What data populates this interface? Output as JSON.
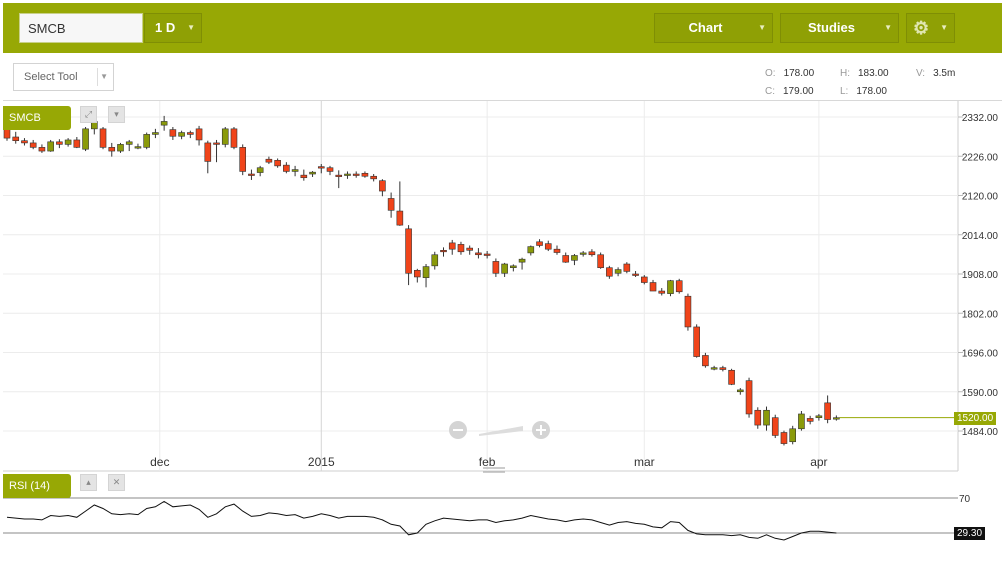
{
  "header": {
    "symbol": "SMCB",
    "interval": "1 D",
    "chart_label": "Chart",
    "studies_label": "Studies",
    "settings_icon": "gear-icon"
  },
  "toolbar": {
    "select_tool": "Select Tool"
  },
  "ohlc": {
    "o_key": "O:",
    "o_val": "178.00",
    "h_key": "H:",
    "h_val": "183.00",
    "v_key": "V:",
    "v_val": "3.5m",
    "c_key": "C:",
    "c_val": "179.00",
    "l_key": "L:",
    "l_val": "178.00"
  },
  "main_panel": {
    "series_tag": "SMCB",
    "expand_icon": "expand-icon",
    "down_icon": "arrow-down-icon",
    "current_price": "1520.00",
    "zoom_out_icon": "zoom-out-icon",
    "zoom_in_icon": "zoom-in-icon"
  },
  "rsi_panel": {
    "tag": "RSI (14)",
    "level_label": "70",
    "current_value": "29.30",
    "up_icon": "arrow-up-icon",
    "close_icon": "close-icon"
  },
  "colors": {
    "accent": "#97a805",
    "up": "#8a9a0a",
    "down": "#f0441a"
  },
  "chart_data": {
    "type": "candlestick",
    "y_ticks": [
      "2332.00",
      "2226.00",
      "2120.00",
      "2014.00",
      "1908.00",
      "1802.00",
      "1696.00",
      "1590.00",
      "1484.00"
    ],
    "x_ticks": [
      "dec",
      "2015",
      "feb",
      "mar",
      "apr"
    ],
    "ylim": [
      1460,
      2350
    ],
    "candles": [
      [
        2300,
        2315,
        2268,
        2275
      ],
      [
        2278,
        2292,
        2260,
        2268
      ],
      [
        2268,
        2275,
        2255,
        2262
      ],
      [
        2262,
        2270,
        2245,
        2250
      ],
      [
        2250,
        2258,
        2235,
        2240
      ],
      [
        2240,
        2270,
        2238,
        2265
      ],
      [
        2265,
        2272,
        2248,
        2258
      ],
      [
        2258,
        2275,
        2252,
        2270
      ],
      [
        2270,
        2278,
        2248,
        2250
      ],
      [
        2245,
        2305,
        2240,
        2300
      ],
      [
        2300,
        2330,
        2285,
        2320
      ],
      [
        2300,
        2305,
        2245,
        2250
      ],
      [
        2250,
        2262,
        2225,
        2240
      ],
      [
        2240,
        2262,
        2235,
        2258
      ],
      [
        2258,
        2270,
        2240,
        2265
      ],
      [
        2250,
        2260,
        2245,
        2252
      ],
      [
        2250,
        2290,
        2245,
        2285
      ],
      [
        2285,
        2300,
        2275,
        2290
      ],
      [
        2310,
        2335,
        2295,
        2320
      ],
      [
        2298,
        2305,
        2270,
        2280
      ],
      [
        2280,
        2295,
        2272,
        2290
      ],
      [
        2290,
        2295,
        2275,
        2285
      ],
      [
        2300,
        2308,
        2255,
        2270
      ],
      [
        2262,
        2268,
        2180,
        2212
      ],
      [
        2262,
        2270,
        2210,
        2258
      ],
      [
        2258,
        2305,
        2250,
        2300
      ],
      [
        2300,
        2305,
        2245,
        2250
      ],
      [
        2250,
        2258,
        2175,
        2185
      ],
      [
        2178,
        2190,
        2162,
        2175
      ],
      [
        2182,
        2200,
        2172,
        2195
      ],
      [
        2218,
        2225,
        2205,
        2210
      ],
      [
        2215,
        2220,
        2195,
        2200
      ],
      [
        2202,
        2210,
        2180,
        2185
      ],
      [
        2185,
        2200,
        2172,
        2190
      ],
      [
        2175,
        2190,
        2160,
        2168
      ],
      [
        2178,
        2186,
        2170,
        2183
      ],
      [
        2198,
        2205,
        2180,
        2195
      ],
      [
        2195,
        2200,
        2175,
        2185
      ],
      [
        2175,
        2188,
        2140,
        2172
      ],
      [
        2175,
        2185,
        2165,
        2178
      ],
      [
        2178,
        2185,
        2168,
        2175
      ],
      [
        2180,
        2185,
        2168,
        2172
      ],
      [
        2172,
        2178,
        2158,
        2165
      ],
      [
        2160,
        2164,
        2118,
        2132
      ],
      [
        2112,
        2128,
        2060,
        2080
      ],
      [
        2078,
        2158,
        2038,
        2040
      ],
      [
        2030,
        2040,
        1878,
        1910
      ],
      [
        1918,
        1922,
        1885,
        1900
      ],
      [
        1898,
        1935,
        1872,
        1928
      ],
      [
        1930,
        1968,
        1920,
        1960
      ],
      [
        1972,
        1980,
        1955,
        1968
      ],
      [
        1992,
        2000,
        1960,
        1975
      ],
      [
        1988,
        1995,
        1960,
        1968
      ],
      [
        1978,
        1985,
        1960,
        1972
      ],
      [
        1965,
        1978,
        1950,
        1960
      ],
      [
        1962,
        1970,
        1950,
        1958
      ],
      [
        1942,
        1950,
        1900,
        1910
      ],
      [
        1910,
        1938,
        1900,
        1935
      ],
      [
        1925,
        1934,
        1915,
        1930
      ],
      [
        1940,
        1952,
        1920,
        1948
      ],
      [
        1965,
        1985,
        1958,
        1982
      ],
      [
        1995,
        2002,
        1980,
        1985
      ],
      [
        1990,
        1998,
        1970,
        1975
      ],
      [
        1975,
        1985,
        1960,
        1966
      ],
      [
        1958,
        1966,
        1938,
        1940
      ],
      [
        1945,
        1962,
        1932,
        1958
      ],
      [
        1962,
        1970,
        1955,
        1965
      ],
      [
        1968,
        1975,
        1955,
        1960
      ],
      [
        1960,
        1966,
        1922,
        1925
      ],
      [
        1925,
        1930,
        1895,
        1902
      ],
      [
        1910,
        1926,
        1902,
        1920
      ],
      [
        1935,
        1940,
        1910,
        1915
      ],
      [
        1908,
        1916,
        1900,
        1907
      ],
      [
        1900,
        1905,
        1880,
        1885
      ],
      [
        1885,
        1892,
        1862,
        1862
      ],
      [
        1862,
        1870,
        1850,
        1856
      ],
      [
        1855,
        1892,
        1848,
        1890
      ],
      [
        1890,
        1895,
        1855,
        1860
      ],
      [
        1848,
        1855,
        1755,
        1765
      ],
      [
        1765,
        1772,
        1682,
        1685
      ],
      [
        1688,
        1695,
        1655,
        1660
      ],
      [
        1652,
        1660,
        1648,
        1655
      ],
      [
        1655,
        1660,
        1645,
        1650
      ],
      [
        1648,
        1652,
        1608,
        1610
      ],
      [
        1590,
        1600,
        1582,
        1595
      ],
      [
        1620,
        1628,
        1520,
        1530
      ],
      [
        1540,
        1548,
        1490,
        1500
      ],
      [
        1500,
        1550,
        1485,
        1540
      ],
      [
        1520,
        1528,
        1465,
        1472
      ],
      [
        1480,
        1485,
        1445,
        1450
      ],
      [
        1455,
        1498,
        1448,
        1490
      ],
      [
        1490,
        1538,
        1485,
        1530
      ],
      [
        1518,
        1525,
        1502,
        1510
      ],
      [
        1520,
        1530,
        1512,
        1525
      ],
      [
        1560,
        1580,
        1505,
        1515
      ],
      [
        1520,
        1526,
        1512,
        1520
      ]
    ],
    "rsi": [
      48,
      47,
      46,
      46,
      45,
      50,
      49,
      50,
      48,
      55,
      62,
      58,
      52,
      51,
      52,
      51,
      58,
      60,
      66,
      60,
      61,
      62,
      57,
      48,
      52,
      60,
      63,
      55,
      49,
      50,
      53,
      52,
      50,
      51,
      47,
      49,
      52,
      50,
      47,
      49,
      49,
      49,
      48,
      45,
      40,
      38,
      28,
      30,
      40,
      44,
      47,
      46,
      45,
      44,
      45,
      45,
      42,
      44,
      45,
      47,
      50,
      48,
      46,
      45,
      43,
      45,
      46,
      45,
      42,
      39,
      42,
      43,
      41,
      40,
      37,
      36,
      43,
      42,
      33,
      29,
      28,
      28,
      28,
      27,
      28,
      25,
      24,
      28,
      24,
      22,
      26,
      30,
      32,
      32,
      31,
      30
    ]
  }
}
